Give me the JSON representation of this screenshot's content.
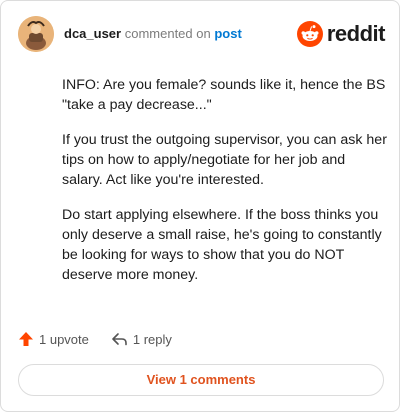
{
  "header": {
    "username": "dca_user",
    "action_text": "commented on",
    "post_link": "post",
    "brand_name": "reddit",
    "brand_color": "#ff4500"
  },
  "comment": {
    "paragraphs": [
      "INFO: Are you female? sounds like it, hence the BS \"take a pay decrease...\"",
      "If you trust the outgoing supervisor, you can ask her tips on how to apply/negotiate for her job and salary. Act like you're interested.",
      "Do start applying elsewhere. If the boss thinks you only deserve a small raise, he's going to constantly be looking for ways to show that you do NOT deserve more money."
    ]
  },
  "actions": {
    "upvote_label": "1 upvote",
    "reply_label": "1 reply",
    "upvote_icon": "upvote-arrow-icon",
    "reply_icon": "reply-arrow-icon",
    "upvote_color": "#ff4500"
  },
  "footer": {
    "view_comments_label": "View 1 comments",
    "accent_color": "#e0531f"
  }
}
